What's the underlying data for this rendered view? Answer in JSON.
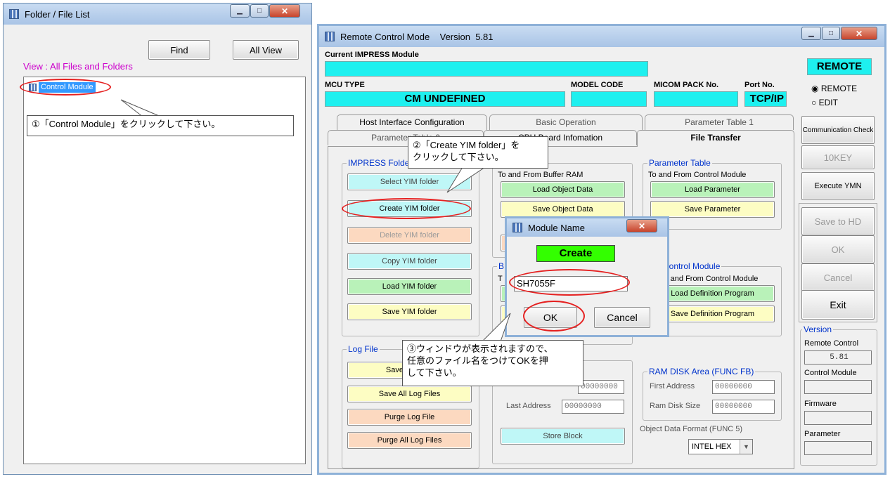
{
  "folder_window": {
    "title": "Folder / File List",
    "find_label": "Find",
    "all_view_label": "All View",
    "view_label": "View : All Files and Folders",
    "tree_item": "Control Module"
  },
  "remote_window": {
    "title": "Remote Control Mode    Version  5.81",
    "current_module_label": "Current IMPRESS Module",
    "mode_badge": "REMOTE",
    "mcu_type_label": "MCU TYPE",
    "mcu_type_value": "CM UNDEFINED",
    "model_code_label": "MODEL CODE",
    "micom_pack_label": "MICOM PACK No.",
    "port_label": "Port No.",
    "port_value": "TCP/IP",
    "radio_remote": "REMOTE",
    "radio_edit": "EDIT",
    "tabs": [
      "Host Interface Configuration",
      "Basic Operation",
      "Parameter Table 1",
      "Parameter Table 2",
      "CPU Board Infomation",
      "File Transfer"
    ],
    "impress_group": "IMPRESS Folder",
    "select_yim": "Select YIM folder",
    "create_yim": "Create YIM folder",
    "delete_yim": "Delete YIM folder",
    "copy_yim": "Copy YIM folder",
    "load_yim": "Load YIM folder",
    "save_yim": "Save YIM folder",
    "object_group_sub": "To and From Buffer RAM",
    "load_object": "Load Object Data",
    "save_object": "Save Object Data",
    "param_group": "Parameter Table",
    "param_group_sub": "To and From Control Module",
    "load_param": "Load Parameter",
    "save_param": "Save Parameter",
    "def_group": "Control Module",
    "def_group_sub": "To and From Control Module",
    "load_def": "Load Definition Program",
    "save_def": "Save Definition Program",
    "log_group": "Log File",
    "save_log": "Save Log File",
    "save_all_log": "Save All Log Files",
    "purge_log": "Purge Log File",
    "purge_all_log": "Purge All Log Files",
    "first_address_value": "00000000",
    "last_address_label": "Last Address",
    "last_address_value": "00000000",
    "store_block": "Store Block",
    "ram_disk_group": "RAM DISK Area (FUNC FB)",
    "ram_first_label": "First Address",
    "ram_first_value": "00000000",
    "ram_size_label": "Ram Disk Size",
    "ram_size_value": "00000000",
    "object_format_label": "Object Data Format (FUNC 5)",
    "object_format_value": "INTEL HEX",
    "comm_check": "Communication Check",
    "tenkey": "10KEY",
    "execute_ymn": "Execute YMN",
    "save_hd": "Save to HD",
    "ok": "OK",
    "cancel": "Cancel",
    "exit": "Exit",
    "version_group": "Version",
    "remote_control_label": "Remote Control",
    "remote_control_value": "5.81",
    "control_module_label": "Control Module",
    "firmware_label": "Firmware",
    "parameter_label": "Parameter"
  },
  "dialog": {
    "title": "Module Name",
    "create_label": "Create",
    "input_value": "SH7055F",
    "ok_label": "OK",
    "cancel_label": "Cancel"
  },
  "callouts": {
    "step1": "①「Control Module」をクリックして下さい。",
    "step2_line1": "②「Create YIM folder」を",
    "step2_line2": "クリックして下さい。",
    "step3_line1": "③ウィンドウが表示されますので、",
    "step3_line2": "任意のファイル名をつけてOKを押",
    "step3_line3": "して下さい。"
  },
  "colors": {
    "accent_cyan": "#1ef0ef",
    "create_green": "#33ff00",
    "highlight_red": "#e52020",
    "group_title_blue": "#0033cc"
  }
}
